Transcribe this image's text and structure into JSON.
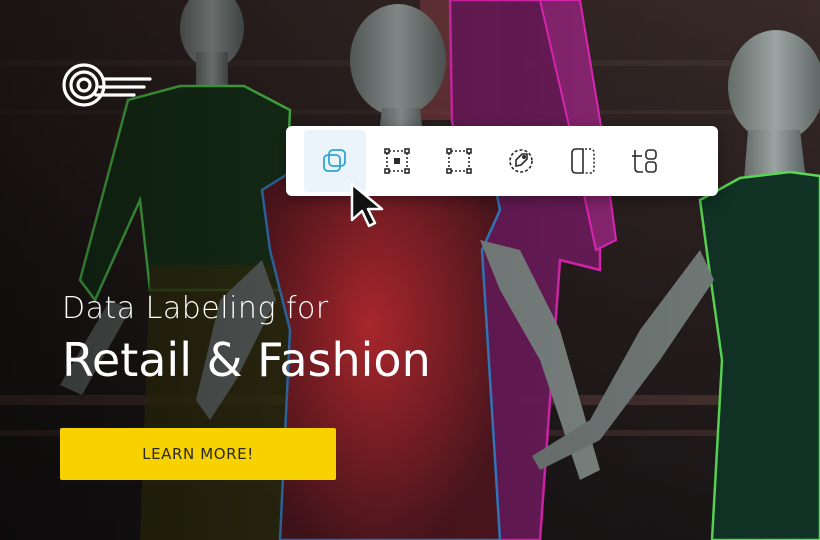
{
  "hero": {
    "subtitle": "Data Labeling for",
    "title": "Retail & Fashion",
    "cta_label": "LEARN MORE!"
  },
  "toolbar": {
    "tools": [
      {
        "icon": "overlap-squares-icon",
        "active": true
      },
      {
        "icon": "bounding-box-point-icon",
        "active": false
      },
      {
        "icon": "bounding-box-icon",
        "active": false
      },
      {
        "icon": "polygon-tag-icon",
        "active": false
      },
      {
        "icon": "split-frame-icon",
        "active": false
      },
      {
        "icon": "text-tag-icon",
        "active": false
      }
    ]
  },
  "colors": {
    "accent_yellow": "#f7d200",
    "outline_green": "#5ee65a",
    "outline_blue": "#3d8fe0",
    "outline_magenta": "#ff2bd0",
    "active_tool": "#2fa3d6"
  }
}
